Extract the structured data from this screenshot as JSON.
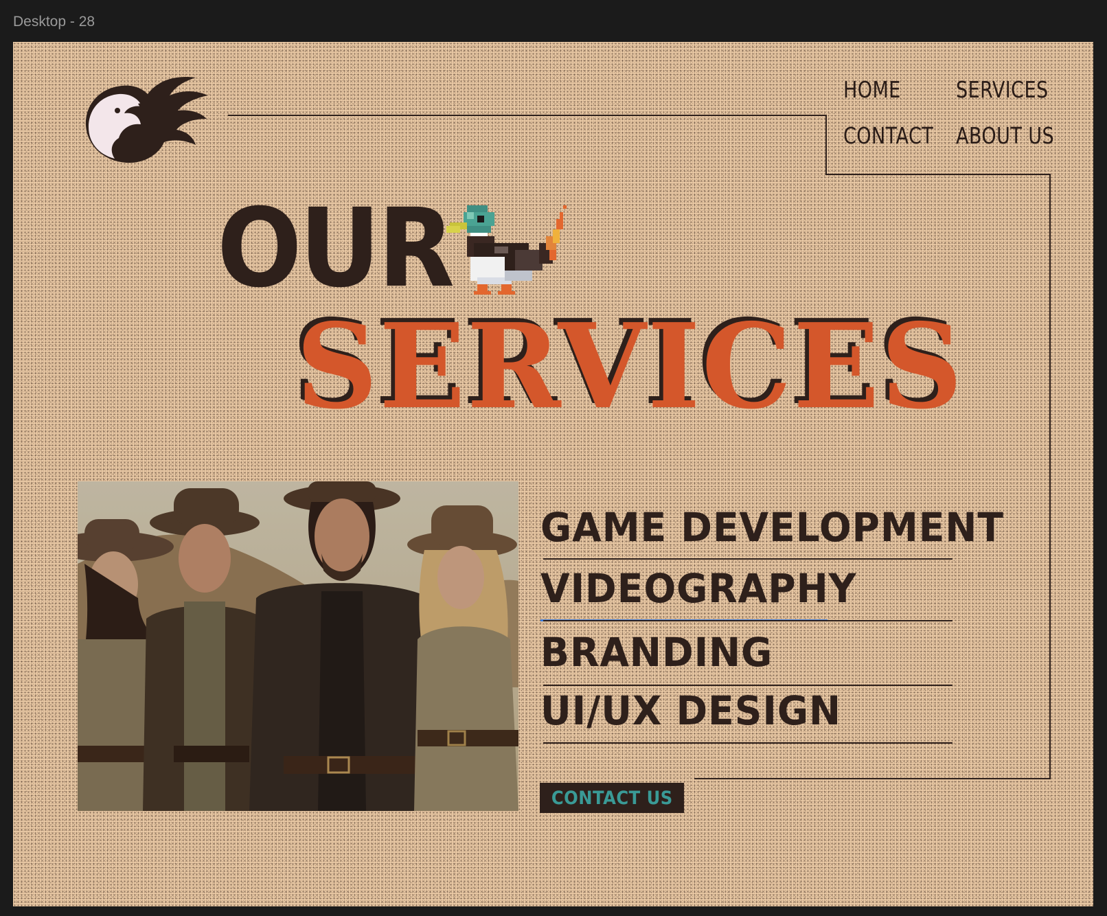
{
  "frame": {
    "label": "Desktop - 28"
  },
  "nav": {
    "home": "HOME",
    "services": "SERVICES",
    "contact": "CONTACT",
    "about": "ABOUT US"
  },
  "hero": {
    "line1": "OUR",
    "line2": "SERVICES"
  },
  "services": [
    {
      "label": "GAME DEVELOPMENT"
    },
    {
      "label": "VIDEOGRAPHY"
    },
    {
      "label": "BRANDING"
    },
    {
      "label": "UI/UX DESIGN"
    }
  ],
  "cta": {
    "label": "CONTACT US"
  },
  "colors": {
    "background": "#e9c9a5",
    "dark": "#2e201b",
    "accent": "#d4572b",
    "cta_text": "#3a9a96",
    "app_chrome": "#1b1b1b"
  },
  "icons": {
    "logo": "flaming-bird-logo",
    "mascot": "pixel-duck-icon"
  }
}
